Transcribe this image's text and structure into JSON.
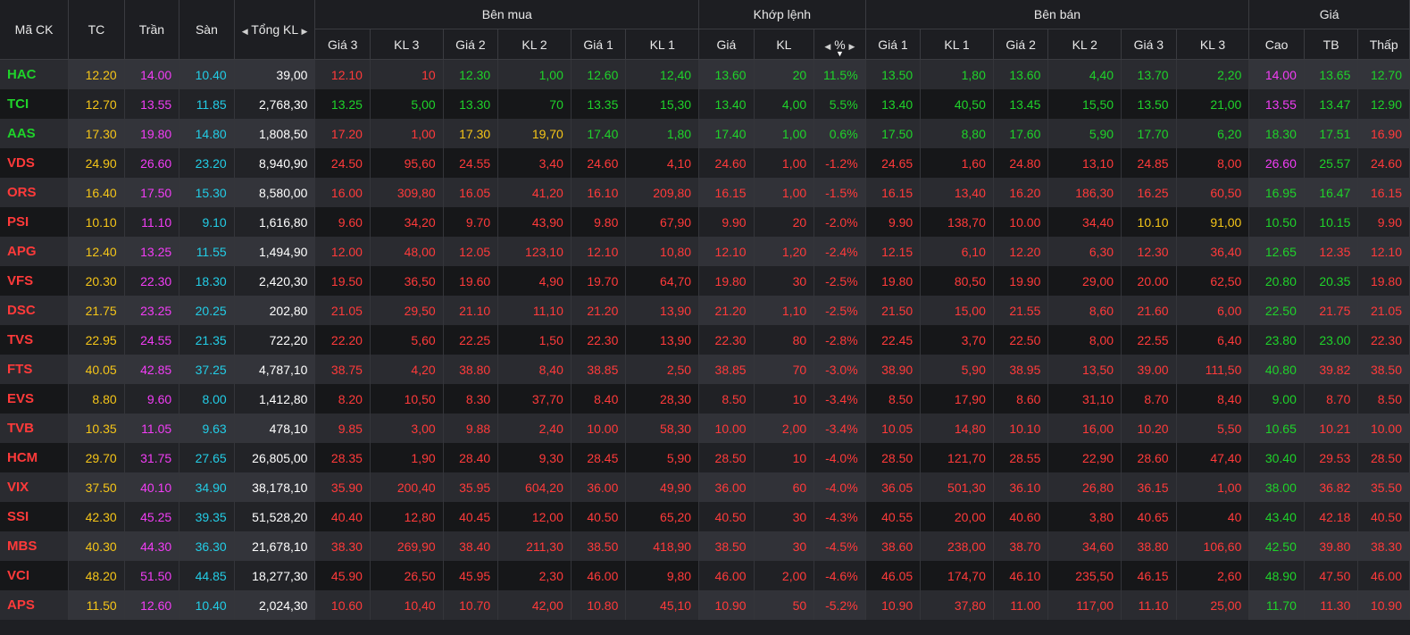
{
  "headers": {
    "symbol": "Mã CK",
    "ref": "TC",
    "ceil": "Trần",
    "floor": "Sàn",
    "total_vol": "Tổng KL",
    "buy_side": "Bên mua",
    "matched": "Khớp lệnh",
    "sell_side": "Bên bán",
    "price": "Giá",
    "buy_cols": [
      "Giá 3",
      "KL 3",
      "Giá 2",
      "KL 2",
      "Giá 1",
      "KL 1"
    ],
    "match_cols": [
      "Giá",
      "KL",
      "%"
    ],
    "sell_cols": [
      "Giá 1",
      "KL 1",
      "Giá 2",
      "KL 2",
      "Giá 3",
      "KL 3"
    ],
    "price_cols": [
      "Cao",
      "TB",
      "Thấp"
    ]
  },
  "colors": {
    "up": "#1fd32a",
    "down": "#ff3a3a",
    "ref": "#f5c518",
    "ceiling": "#f23df5",
    "floor": "#22cde6"
  },
  "rows": [
    {
      "symbol": "HAC",
      "ref": "12.20",
      "ceil": "14.00",
      "floor": "10.40",
      "vol": "39,00",
      "buy": [
        [
          "12.10",
          "10"
        ],
        [
          "12.30",
          "1,00"
        ],
        [
          "12.60",
          "12,40"
        ]
      ],
      "match": [
        "13.60",
        "20",
        "11.5%"
      ],
      "sell": [
        [
          "13.50",
          "1,80"
        ],
        [
          "13.60",
          "4,40"
        ],
        [
          "13.70",
          "2,20"
        ]
      ],
      "high": "14.00",
      "avg": "13.65",
      "low": "12.70",
      "cls": {
        "sym": "up",
        "b3": "down",
        "b2": "up",
        "b1": "up",
        "m": "up",
        "s1": "up",
        "s2": "up",
        "s3": "up",
        "hi": "ceil",
        "av": "up",
        "lo": "up"
      }
    },
    {
      "symbol": "TCI",
      "ref": "12.70",
      "ceil": "13.55",
      "floor": "11.85",
      "vol": "2,768,30",
      "buy": [
        [
          "13.25",
          "5,00"
        ],
        [
          "13.30",
          "70"
        ],
        [
          "13.35",
          "15,30"
        ]
      ],
      "match": [
        "13.40",
        "4,00",
        "5.5%"
      ],
      "sell": [
        [
          "13.40",
          "40,50"
        ],
        [
          "13.45",
          "15,50"
        ],
        [
          "13.50",
          "21,00"
        ]
      ],
      "high": "13.55",
      "avg": "13.47",
      "low": "12.90",
      "cls": {
        "sym": "up",
        "b3": "up",
        "b2": "up",
        "b1": "up",
        "m": "up",
        "s1": "up",
        "s2": "up",
        "s3": "up",
        "hi": "ceil",
        "av": "up",
        "lo": "up"
      }
    },
    {
      "symbol": "AAS",
      "ref": "17.30",
      "ceil": "19.80",
      "floor": "14.80",
      "vol": "1,808,50",
      "buy": [
        [
          "17.20",
          "1,00"
        ],
        [
          "17.30",
          "19,70"
        ],
        [
          "17.40",
          "1,80"
        ]
      ],
      "match": [
        "17.40",
        "1,00",
        "0.6%"
      ],
      "sell": [
        [
          "17.50",
          "8,80"
        ],
        [
          "17.60",
          "5,90"
        ],
        [
          "17.70",
          "6,20"
        ]
      ],
      "high": "18.30",
      "avg": "17.51",
      "low": "16.90",
      "cls": {
        "sym": "up",
        "b3": "down",
        "b2": "ref",
        "b1": "up",
        "m": "up",
        "s1": "up",
        "s2": "up",
        "s3": "up",
        "hi": "up",
        "av": "up",
        "lo": "down"
      }
    },
    {
      "symbol": "VDS",
      "ref": "24.90",
      "ceil": "26.60",
      "floor": "23.20",
      "vol": "8,940,90",
      "buy": [
        [
          "24.50",
          "95,60"
        ],
        [
          "24.55",
          "3,40"
        ],
        [
          "24.60",
          "4,10"
        ]
      ],
      "match": [
        "24.60",
        "1,00",
        "-1.2%"
      ],
      "sell": [
        [
          "24.65",
          "1,60"
        ],
        [
          "24.80",
          "13,10"
        ],
        [
          "24.85",
          "8,00"
        ]
      ],
      "high": "26.60",
      "avg": "25.57",
      "low": "24.60",
      "cls": {
        "sym": "down",
        "b3": "down",
        "b2": "down",
        "b1": "down",
        "m": "down",
        "s1": "down",
        "s2": "down",
        "s3": "down",
        "hi": "ceil",
        "av": "up",
        "lo": "down"
      }
    },
    {
      "symbol": "ORS",
      "ref": "16.40",
      "ceil": "17.50",
      "floor": "15.30",
      "vol": "8,580,00",
      "buy": [
        [
          "16.00",
          "309,80"
        ],
        [
          "16.05",
          "41,20"
        ],
        [
          "16.10",
          "209,80"
        ]
      ],
      "match": [
        "16.15",
        "1,00",
        "-1.5%"
      ],
      "sell": [
        [
          "16.15",
          "13,40"
        ],
        [
          "16.20",
          "186,30"
        ],
        [
          "16.25",
          "60,50"
        ]
      ],
      "high": "16.95",
      "avg": "16.47",
      "low": "16.15",
      "cls": {
        "sym": "down",
        "b3": "down",
        "b2": "down",
        "b1": "down",
        "m": "down",
        "s1": "down",
        "s2": "down",
        "s3": "down",
        "hi": "up",
        "av": "up",
        "lo": "down"
      }
    },
    {
      "symbol": "PSI",
      "ref": "10.10",
      "ceil": "11.10",
      "floor": "9.10",
      "vol": "1,616,80",
      "buy": [
        [
          "9.60",
          "34,20"
        ],
        [
          "9.70",
          "43,90"
        ],
        [
          "9.80",
          "67,90"
        ]
      ],
      "match": [
        "9.90",
        "20",
        "-2.0%"
      ],
      "sell": [
        [
          "9.90",
          "138,70"
        ],
        [
          "10.00",
          "34,40"
        ],
        [
          "10.10",
          "91,00"
        ]
      ],
      "high": "10.50",
      "avg": "10.15",
      "low": "9.90",
      "cls": {
        "sym": "down",
        "b3": "down",
        "b2": "down",
        "b1": "down",
        "m": "down",
        "s1": "down",
        "s2": "down",
        "s3": "ref",
        "hi": "up",
        "av": "up",
        "lo": "down"
      }
    },
    {
      "symbol": "APG",
      "ref": "12.40",
      "ceil": "13.25",
      "floor": "11.55",
      "vol": "1,494,90",
      "buy": [
        [
          "12.00",
          "48,00"
        ],
        [
          "12.05",
          "123,10"
        ],
        [
          "12.10",
          "10,80"
        ]
      ],
      "match": [
        "12.10",
        "1,20",
        "-2.4%"
      ],
      "sell": [
        [
          "12.15",
          "6,10"
        ],
        [
          "12.20",
          "6,30"
        ],
        [
          "12.30",
          "36,40"
        ]
      ],
      "high": "12.65",
      "avg": "12.35",
      "low": "12.10",
      "cls": {
        "sym": "down",
        "b3": "down",
        "b2": "down",
        "b1": "down",
        "m": "down",
        "s1": "down",
        "s2": "down",
        "s3": "down",
        "hi": "up",
        "av": "down",
        "lo": "down"
      }
    },
    {
      "symbol": "VFS",
      "ref": "20.30",
      "ceil": "22.30",
      "floor": "18.30",
      "vol": "2,420,30",
      "buy": [
        [
          "19.50",
          "36,50"
        ],
        [
          "19.60",
          "4,90"
        ],
        [
          "19.70",
          "64,70"
        ]
      ],
      "match": [
        "19.80",
        "30",
        "-2.5%"
      ],
      "sell": [
        [
          "19.80",
          "80,50"
        ],
        [
          "19.90",
          "29,00"
        ],
        [
          "20.00",
          "62,50"
        ]
      ],
      "high": "20.80",
      "avg": "20.35",
      "low": "19.80",
      "cls": {
        "sym": "down",
        "b3": "down",
        "b2": "down",
        "b1": "down",
        "m": "down",
        "s1": "down",
        "s2": "down",
        "s3": "down",
        "hi": "up",
        "av": "up",
        "lo": "down"
      }
    },
    {
      "symbol": "DSC",
      "ref": "21.75",
      "ceil": "23.25",
      "floor": "20.25",
      "vol": "202,80",
      "buy": [
        [
          "21.05",
          "29,50"
        ],
        [
          "21.10",
          "11,10"
        ],
        [
          "21.20",
          "13,90"
        ]
      ],
      "match": [
        "21.20",
        "1,10",
        "-2.5%"
      ],
      "sell": [
        [
          "21.50",
          "15,00"
        ],
        [
          "21.55",
          "8,60"
        ],
        [
          "21.60",
          "6,00"
        ]
      ],
      "high": "22.50",
      "avg": "21.75",
      "low": "21.05",
      "cls": {
        "sym": "down",
        "b3": "down",
        "b2": "down",
        "b1": "down",
        "m": "down",
        "s1": "down",
        "s2": "down",
        "s3": "down",
        "hi": "up",
        "av": "down",
        "lo": "down"
      }
    },
    {
      "symbol": "TVS",
      "ref": "22.95",
      "ceil": "24.55",
      "floor": "21.35",
      "vol": "722,20",
      "buy": [
        [
          "22.20",
          "5,60"
        ],
        [
          "22.25",
          "1,50"
        ],
        [
          "22.30",
          "13,90"
        ]
      ],
      "match": [
        "22.30",
        "80",
        "-2.8%"
      ],
      "sell": [
        [
          "22.45",
          "3,70"
        ],
        [
          "22.50",
          "8,00"
        ],
        [
          "22.55",
          "6,40"
        ]
      ],
      "high": "23.80",
      "avg": "23.00",
      "low": "22.30",
      "cls": {
        "sym": "down",
        "b3": "down",
        "b2": "down",
        "b1": "down",
        "m": "down",
        "s1": "down",
        "s2": "down",
        "s3": "down",
        "hi": "up",
        "av": "up",
        "lo": "down"
      }
    },
    {
      "symbol": "FTS",
      "ref": "40.05",
      "ceil": "42.85",
      "floor": "37.25",
      "vol": "4,787,10",
      "buy": [
        [
          "38.75",
          "4,20"
        ],
        [
          "38.80",
          "8,40"
        ],
        [
          "38.85",
          "2,50"
        ]
      ],
      "match": [
        "38.85",
        "70",
        "-3.0%"
      ],
      "sell": [
        [
          "38.90",
          "5,90"
        ],
        [
          "38.95",
          "13,50"
        ],
        [
          "39.00",
          "111,50"
        ]
      ],
      "high": "40.80",
      "avg": "39.82",
      "low": "38.50",
      "cls": {
        "sym": "down",
        "b3": "down",
        "b2": "down",
        "b1": "down",
        "m": "down",
        "s1": "down",
        "s2": "down",
        "s3": "down",
        "hi": "up",
        "av": "down",
        "lo": "down"
      }
    },
    {
      "symbol": "EVS",
      "ref": "8.80",
      "ceil": "9.60",
      "floor": "8.00",
      "vol": "1,412,80",
      "buy": [
        [
          "8.20",
          "10,50"
        ],
        [
          "8.30",
          "37,70"
        ],
        [
          "8.40",
          "28,30"
        ]
      ],
      "match": [
        "8.50",
        "10",
        "-3.4%"
      ],
      "sell": [
        [
          "8.50",
          "17,90"
        ],
        [
          "8.60",
          "31,10"
        ],
        [
          "8.70",
          "8,40"
        ]
      ],
      "high": "9.00",
      "avg": "8.70",
      "low": "8.50",
      "cls": {
        "sym": "down",
        "b3": "down",
        "b2": "down",
        "b1": "down",
        "m": "down",
        "s1": "down",
        "s2": "down",
        "s3": "down",
        "hi": "up",
        "av": "down",
        "lo": "down"
      }
    },
    {
      "symbol": "TVB",
      "ref": "10.35",
      "ceil": "11.05",
      "floor": "9.63",
      "vol": "478,10",
      "buy": [
        [
          "9.85",
          "3,00"
        ],
        [
          "9.88",
          "2,40"
        ],
        [
          "10.00",
          "58,30"
        ]
      ],
      "match": [
        "10.00",
        "2,00",
        "-3.4%"
      ],
      "sell": [
        [
          "10.05",
          "14,80"
        ],
        [
          "10.10",
          "16,00"
        ],
        [
          "10.20",
          "5,50"
        ]
      ],
      "high": "10.65",
      "avg": "10.21",
      "low": "10.00",
      "cls": {
        "sym": "down",
        "b3": "down",
        "b2": "down",
        "b1": "down",
        "m": "down",
        "s1": "down",
        "s2": "down",
        "s3": "down",
        "hi": "up",
        "av": "down",
        "lo": "down"
      }
    },
    {
      "symbol": "HCM",
      "ref": "29.70",
      "ceil": "31.75",
      "floor": "27.65",
      "vol": "26,805,00",
      "buy": [
        [
          "28.35",
          "1,90"
        ],
        [
          "28.40",
          "9,30"
        ],
        [
          "28.45",
          "5,90"
        ]
      ],
      "match": [
        "28.50",
        "10",
        "-4.0%"
      ],
      "sell": [
        [
          "28.50",
          "121,70"
        ],
        [
          "28.55",
          "22,90"
        ],
        [
          "28.60",
          "47,40"
        ]
      ],
      "high": "30.40",
      "avg": "29.53",
      "low": "28.50",
      "cls": {
        "sym": "down",
        "b3": "down",
        "b2": "down",
        "b1": "down",
        "m": "down",
        "s1": "down",
        "s2": "down",
        "s3": "down",
        "hi": "up",
        "av": "down",
        "lo": "down"
      }
    },
    {
      "symbol": "VIX",
      "ref": "37.50",
      "ceil": "40.10",
      "floor": "34.90",
      "vol": "38,178,10",
      "buy": [
        [
          "35.90",
          "200,40"
        ],
        [
          "35.95",
          "604,20"
        ],
        [
          "36.00",
          "49,90"
        ]
      ],
      "match": [
        "36.00",
        "60",
        "-4.0%"
      ],
      "sell": [
        [
          "36.05",
          "501,30"
        ],
        [
          "36.10",
          "26,80"
        ],
        [
          "36.15",
          "1,00"
        ]
      ],
      "high": "38.00",
      "avg": "36.82",
      "low": "35.50",
      "cls": {
        "sym": "down",
        "b3": "down",
        "b2": "down",
        "b1": "down",
        "m": "down",
        "s1": "down",
        "s2": "down",
        "s3": "down",
        "hi": "up",
        "av": "down",
        "lo": "down"
      }
    },
    {
      "symbol": "SSI",
      "ref": "42.30",
      "ceil": "45.25",
      "floor": "39.35",
      "vol": "51,528,20",
      "buy": [
        [
          "40.40",
          "12,80"
        ],
        [
          "40.45",
          "12,00"
        ],
        [
          "40.50",
          "65,20"
        ]
      ],
      "match": [
        "40.50",
        "30",
        "-4.3%"
      ],
      "sell": [
        [
          "40.55",
          "20,00"
        ],
        [
          "40.60",
          "3,80"
        ],
        [
          "40.65",
          "40"
        ]
      ],
      "high": "43.40",
      "avg": "42.18",
      "low": "40.50",
      "cls": {
        "sym": "down",
        "b3": "down",
        "b2": "down",
        "b1": "down",
        "m": "down",
        "s1": "down",
        "s2": "down",
        "s3": "down",
        "hi": "up",
        "av": "down",
        "lo": "down"
      }
    },
    {
      "symbol": "MBS",
      "ref": "40.30",
      "ceil": "44.30",
      "floor": "36.30",
      "vol": "21,678,10",
      "buy": [
        [
          "38.30",
          "269,90"
        ],
        [
          "38.40",
          "211,30"
        ],
        [
          "38.50",
          "418,90"
        ]
      ],
      "match": [
        "38.50",
        "30",
        "-4.5%"
      ],
      "sell": [
        [
          "38.60",
          "238,00"
        ],
        [
          "38.70",
          "34,60"
        ],
        [
          "38.80",
          "106,60"
        ]
      ],
      "high": "42.50",
      "avg": "39.80",
      "low": "38.30",
      "cls": {
        "sym": "down",
        "b3": "down",
        "b2": "down",
        "b1": "down",
        "m": "down",
        "s1": "down",
        "s2": "down",
        "s3": "down",
        "hi": "up",
        "av": "down",
        "lo": "down"
      }
    },
    {
      "symbol": "VCI",
      "ref": "48.20",
      "ceil": "51.50",
      "floor": "44.85",
      "vol": "18,277,30",
      "buy": [
        [
          "45.90",
          "26,50"
        ],
        [
          "45.95",
          "2,30"
        ],
        [
          "46.00",
          "9,80"
        ]
      ],
      "match": [
        "46.00",
        "2,00",
        "-4.6%"
      ],
      "sell": [
        [
          "46.05",
          "174,70"
        ],
        [
          "46.10",
          "235,50"
        ],
        [
          "46.15",
          "2,60"
        ]
      ],
      "high": "48.90",
      "avg": "47.50",
      "low": "46.00",
      "cls": {
        "sym": "down",
        "b3": "down",
        "b2": "down",
        "b1": "down",
        "m": "down",
        "s1": "down",
        "s2": "down",
        "s3": "down",
        "hi": "up",
        "av": "down",
        "lo": "down"
      }
    },
    {
      "symbol": "APS",
      "ref": "11.50",
      "ceil": "12.60",
      "floor": "10.40",
      "vol": "2,024,30",
      "buy": [
        [
          "10.60",
          "10,40"
        ],
        [
          "10.70",
          "42,00"
        ],
        [
          "10.80",
          "45,10"
        ]
      ],
      "match": [
        "10.90",
        "50",
        "-5.2%"
      ],
      "sell": [
        [
          "10.90",
          "37,80"
        ],
        [
          "11.00",
          "117,00"
        ],
        [
          "11.10",
          "25,00"
        ]
      ],
      "high": "11.70",
      "avg": "11.30",
      "low": "10.90",
      "cls": {
        "sym": "down",
        "b3": "down",
        "b2": "down",
        "b1": "down",
        "m": "down",
        "s1": "down",
        "s2": "down",
        "s3": "down",
        "hi": "up",
        "av": "down",
        "lo": "down"
      }
    }
  ]
}
